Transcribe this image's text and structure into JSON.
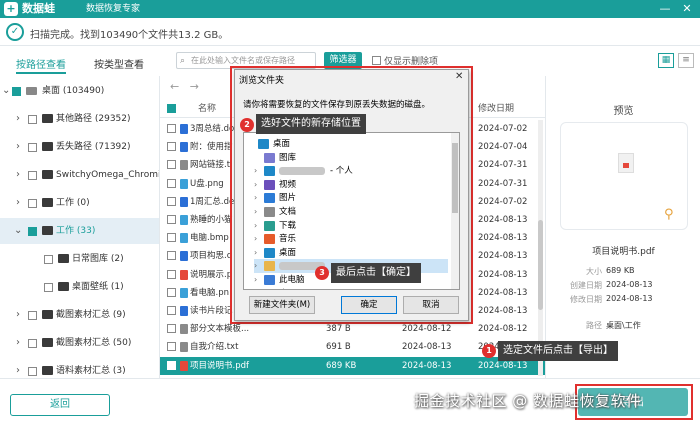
{
  "app": {
    "name": "数据蛙",
    "subtitle": "数据恢复专家",
    "logo": "+",
    "window_controls": {
      "minimize": "—",
      "close": "✕"
    }
  },
  "status": {
    "text": "扫描完成。找到103490个文件共13.2 GB。"
  },
  "toolbar": {
    "tab_path": "按路径查看",
    "tab_type": "按类型查看",
    "search_placeholder": "在此处输入文件名或保存路径",
    "filter_label": "筛选器",
    "deleted_only_label": "仅显示删除项"
  },
  "tree": {
    "items": [
      {
        "label": "桌面 (103490)"
      },
      {
        "label": "其他路径 (29352)"
      },
      {
        "label": "丢失路径 (71392)"
      },
      {
        "label": "SwitchyOmega_Chromium"
      },
      {
        "label": "工作 (0)"
      },
      {
        "label": "工作 (33)"
      },
      {
        "label": "日常图库 (2)"
      },
      {
        "label": "桌面壁纸 (1)"
      },
      {
        "label": "截图素材汇总 (9)"
      },
      {
        "label": "截图素材汇总 (50)"
      },
      {
        "label": "语料素材汇总 (3)"
      }
    ]
  },
  "list": {
    "header": {
      "name": "名称",
      "modified": "修改日期"
    },
    "rows": [
      {
        "name": "3周总结.do",
        "date2": "2024-07-02"
      },
      {
        "name": "附：使用指",
        "date2": "2024-07-04"
      },
      {
        "name": "网站链接.t",
        "date2": "2024-07-31"
      },
      {
        "name": "U盘.png",
        "date2": "2024-07-31"
      },
      {
        "name": "1周汇总.de",
        "date2": "2024-07-02"
      },
      {
        "name": "熟睡的小猫",
        "date2": "2024-08-13"
      },
      {
        "name": "电脑.bmp",
        "date2": "2024-08-13"
      },
      {
        "name": "项目构思.c",
        "date2": "2024-08-13"
      },
      {
        "name": "说明展示.p",
        "date2": "2024-08-13"
      },
      {
        "name": "看电脑.pn",
        "date2": "2024-08-13"
      },
      {
        "name": "读书片段记",
        "date2": "2024-08-13"
      },
      {
        "name": "部分文本模板...",
        "size": "387 B",
        "date": "2024-08-12",
        "date2": "2024-08-12"
      },
      {
        "name": "自我介绍.txt",
        "size": "691 B",
        "date": "2024-08-13",
        "date2": "2024-08-13"
      },
      {
        "name": "项目说明书.pdf",
        "size": "689 KB",
        "date": "2024-08-13",
        "date2": "2024-08-13"
      }
    ]
  },
  "preview": {
    "title": "预览",
    "file_name": "项目说明书.pdf",
    "meta": [
      {
        "key": "大小",
        "value": "689 KB"
      },
      {
        "key": "创建日期",
        "value": "2024-08-13"
      },
      {
        "key": "修改日期",
        "value": "2024-08-13"
      },
      {
        "key": "路径",
        "value": "桌面\\工作"
      }
    ]
  },
  "dialog": {
    "title": "浏览文件夹",
    "close": "✕",
    "prompt": "请你将需要恢复的文件保存到原丢失数据的磁盘。",
    "tree": [
      {
        "label": "桌面",
        "indent": 0,
        "arrow": "",
        "icon": "#1e88c7"
      },
      {
        "label": "图库",
        "indent": 1,
        "arrow": "",
        "icon": "#7a7ad0"
      },
      {
        "label": "- 个人",
        "indent": 1,
        "arrow": "›",
        "icon": "#1e88c7",
        "blur": true
      },
      {
        "label": "视频",
        "indent": 1,
        "arrow": "›",
        "icon": "#6b4fbb"
      },
      {
        "label": "图片",
        "indent": 1,
        "arrow": "›",
        "icon": "#2b7bd6"
      },
      {
        "label": "文档",
        "indent": 1,
        "arrow": "›",
        "icon": "#8a8a8a"
      },
      {
        "label": "下载",
        "indent": 1,
        "arrow": "›",
        "icon": "#2a9d8f"
      },
      {
        "label": "音乐",
        "indent": 1,
        "arrow": "›",
        "icon": "#e65b2a"
      },
      {
        "label": "桌面",
        "indent": 1,
        "arrow": "›",
        "icon": "#1e88c7"
      },
      {
        "label": "",
        "indent": 1,
        "arrow": "›",
        "icon": "#e8b54b",
        "blur": true,
        "highlight": true
      },
      {
        "label": "此电脑",
        "indent": 1,
        "arrow": "›",
        "icon": "#3a7bd5"
      },
      {
        "label": "库",
        "indent": 1,
        "arrow": "›",
        "icon": "#e8b54b"
      }
    ],
    "new_folder": "新建文件夹(M)",
    "ok": "确定",
    "cancel": "取消"
  },
  "callouts": [
    {
      "num": "1",
      "text": "选定文件后点击【导出】"
    },
    {
      "num": "2",
      "text": "选好文件的新存储位置"
    },
    {
      "num": "3",
      "text": "最后点击【确定】"
    }
  ],
  "bottom": {
    "back": "返回",
    "export": "导出",
    "watermark": "掘金技术社区 @ 数据蛙恢复软件"
  },
  "colors": {
    "accent": "#1a9e9a",
    "highlight_red": "#e0302e"
  }
}
